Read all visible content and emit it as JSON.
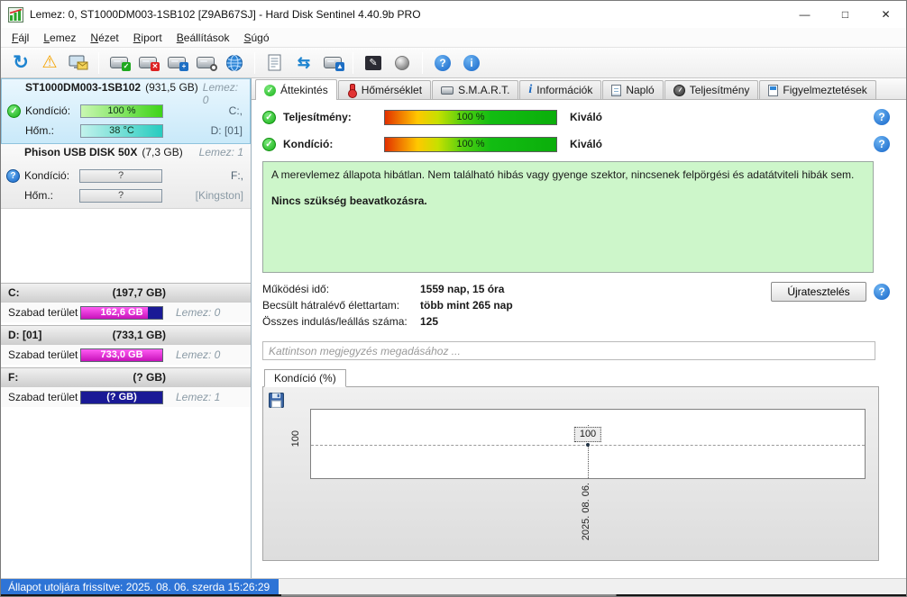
{
  "window": {
    "title": "Lemez: 0, ST1000DM003-1SB102 [Z9AB67SJ]  -  Hard Disk Sentinel 4.40.9b PRO",
    "controls": {
      "minimize": "—",
      "maximize": "□",
      "close": "✕"
    }
  },
  "menu": {
    "items": [
      "Fájl",
      "Lemez",
      "Nézet",
      "Riport",
      "Beállítások",
      "Súgó"
    ]
  },
  "toolbar": {
    "icon_names": [
      "refresh-icon",
      "warning-icon",
      "monitor-mail-icon",
      "disk-ok-icon",
      "disk-remove-icon",
      "disk-tools-icon",
      "disk-search-icon",
      "web-icon",
      "report-icon",
      "sync-icon",
      "disk-report-icon",
      "signature-icon",
      "sphere-icon",
      "help-icon",
      "info-icon"
    ],
    "glyphs": {
      "refresh": "↻",
      "warning": "⚠",
      "sync": "⇆",
      "signature": "✎",
      "help": "?",
      "info": "i"
    }
  },
  "sidebar": {
    "disks": [
      {
        "name": "ST1000DM003-1SB102",
        "size": "(931,5 GB)",
        "disk_no": "Lemez: 0",
        "rows": [
          {
            "label": "Kondíció:",
            "value": "100 %",
            "right": "C:,"
          },
          {
            "label": "Hőm.:",
            "value": "38 °C",
            "right": "D: [01]"
          }
        ]
      },
      {
        "name": "Phison  USB DISK 50X",
        "size": "(7,3 GB)",
        "disk_no": "Lemez: 1",
        "rows": [
          {
            "label": "Kondíció:",
            "value": "?",
            "right": "F:,"
          },
          {
            "label": "Hőm.:",
            "value": "?",
            "right": "[Kingston]"
          }
        ]
      }
    ],
    "partitions": [
      {
        "name": "C:",
        "size": "(197,7 GB)",
        "free_label": "Szabad terület",
        "free_value": "162,6 GB",
        "disk_no": "Lemez: 0",
        "fill": "82%"
      },
      {
        "name": "D: [01]",
        "size": "(733,1 GB)",
        "free_label": "Szabad terület",
        "free_value": "733,0 GB",
        "disk_no": "Lemez: 0",
        "fill": "100%"
      },
      {
        "name": "F:",
        "size": "(? GB)",
        "free_label": "Szabad terület",
        "free_value": "(? GB)",
        "disk_no": "Lemez: 1",
        "fill": "0%"
      }
    ]
  },
  "main": {
    "tabs": [
      {
        "label": "Áttekintés",
        "icon": "check-circle-icon",
        "active": true
      },
      {
        "label": "Hőmérséklet",
        "icon": "thermometer-icon"
      },
      {
        "label": "S.M.A.R.T.",
        "icon": "disk-icon"
      },
      {
        "label": "Információk",
        "icon": "info-icon"
      },
      {
        "label": "Napló",
        "icon": "log-icon"
      },
      {
        "label": "Teljesítmény",
        "icon": "gauge-icon"
      },
      {
        "label": "Figyelmeztetések",
        "icon": "alerts-icon"
      }
    ],
    "performance": {
      "label": "Teljesítmény:",
      "value": "100 %",
      "rating": "Kiváló"
    },
    "condition": {
      "label": "Kondíció:",
      "value": "100 %",
      "rating": "Kiváló"
    },
    "status_box": {
      "line1": "A merevlemez állapota hibátlan. Nem található hibás vagy gyenge szektor, nincsenek felpörgési és adatátviteli hibák sem.",
      "line2": "Nincs szükség beavatkozásra."
    },
    "stats": [
      {
        "label": "Működési idő:",
        "value": "1559 nap, 15 óra"
      },
      {
        "label": "Becsült hátralévő élettartam:",
        "value": "több mint 265 nap"
      },
      {
        "label": "Összes indulás/leállás száma:",
        "value": "125"
      }
    ],
    "retest_button": "Újratesztelés",
    "comment_placeholder": "Kattintson megjegyzés megadásához ...",
    "chart_tab_label": "Kondíció  (%)"
  },
  "chart_data": {
    "type": "line",
    "title": "Kondíció (%)",
    "x": [
      "2025. 08. 06."
    ],
    "series": [
      {
        "name": "Kondíció",
        "values": [
          100
        ]
      }
    ],
    "ytick": "100",
    "point_label": "100",
    "grid": "dashed horizontal at 100",
    "legend": "none"
  },
  "statusbar": {
    "text": "Állapot utoljára frissítve: 2025. 08. 06. szerda 15:26:29"
  }
}
